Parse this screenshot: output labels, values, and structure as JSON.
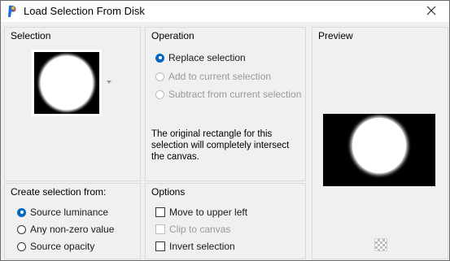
{
  "window": {
    "title": "Load Selection From Disk",
    "close_icon": "close-icon",
    "app_icon": "paintshop-icon"
  },
  "selection": {
    "title": "Selection"
  },
  "operation": {
    "title": "Operation",
    "options": [
      {
        "label": "Replace selection",
        "checked": true,
        "disabled": false
      },
      {
        "label": "Add to current selection",
        "checked": false,
        "disabled": true
      },
      {
        "label": "Subtract from current selection",
        "checked": false,
        "disabled": true
      }
    ],
    "note": "The original rectangle for this selection will completely intersect the canvas."
  },
  "preview": {
    "title": "Preview"
  },
  "create_from": {
    "title": "Create selection from:",
    "options": [
      {
        "label": "Source luminance",
        "checked": true
      },
      {
        "label": "Any non-zero value",
        "checked": false
      },
      {
        "label": "Source opacity",
        "checked": false
      }
    ]
  },
  "options": {
    "title": "Options",
    "items": [
      {
        "label": "Move to upper left",
        "checked": false,
        "disabled": false
      },
      {
        "label": "Clip to canvas",
        "checked": false,
        "disabled": true
      },
      {
        "label": "Invert selection",
        "checked": false,
        "disabled": false
      }
    ]
  },
  "colors": {
    "accent": "#0067c0",
    "preview_bg": "#000000"
  }
}
